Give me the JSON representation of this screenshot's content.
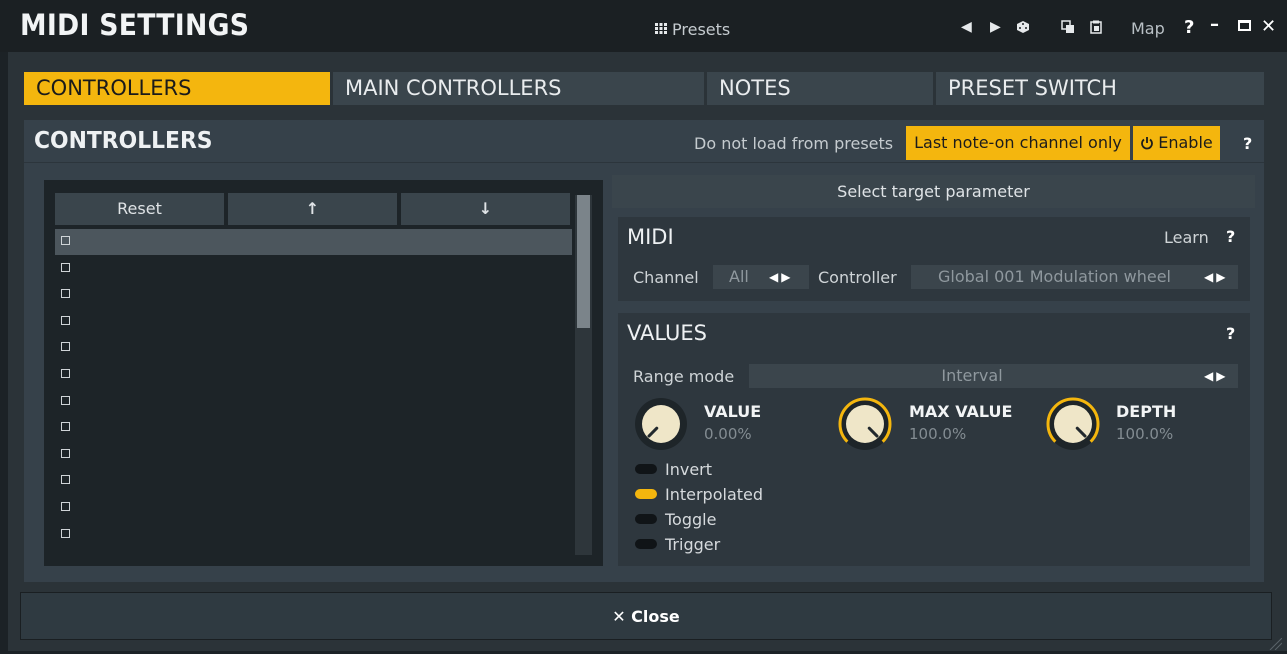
{
  "title": "MIDI SETTINGS",
  "titlebar": {
    "presets_label": "Presets",
    "map_label": "Map",
    "help_label": "?",
    "icons": [
      "prev-arrow-icon",
      "next-arrow-icon",
      "random-icon",
      "copy-icon",
      "paste-icon",
      "minimize-icon",
      "maximize-icon",
      "close-icon"
    ]
  },
  "tabs": [
    {
      "label": "CONTROLLERS",
      "active": true
    },
    {
      "label": "MAIN CONTROLLERS",
      "active": false
    },
    {
      "label": "NOTES",
      "active": false
    },
    {
      "label": "PRESET SWITCH",
      "active": false
    }
  ],
  "controllers": {
    "title": "CONTROLLERS",
    "do_not_load": "Do not load from presets",
    "last_note_on": "Last note-on channel only",
    "enable_label": "Enable",
    "help": "?"
  },
  "list": {
    "reset_label": "Reset",
    "up_label": "↑",
    "down_label": "↓",
    "row_count": 12,
    "selected_row": 0
  },
  "target_button": "Select target parameter",
  "midi": {
    "title": "MIDI",
    "learn_label": "Learn",
    "help": "?",
    "channel_label": "Channel",
    "channel_value": "All",
    "controller_label": "Controller",
    "controller_value": "Global 001 Modulation wheel"
  },
  "values": {
    "title": "VALUES",
    "help": "?",
    "range_mode_label": "Range mode",
    "range_mode_value": "Interval",
    "knobs": [
      {
        "name": "VALUE",
        "value": "0.00%",
        "level": 0.0
      },
      {
        "name": "MAX VALUE",
        "value": "100.0%",
        "level": 1.0
      },
      {
        "name": "DEPTH",
        "value": "100.0%",
        "level": 1.0
      }
    ],
    "toggles": [
      {
        "label": "Invert",
        "on": false
      },
      {
        "label": "Interpolated",
        "on": true
      },
      {
        "label": "Toggle",
        "on": false
      },
      {
        "label": "Trigger",
        "on": false
      }
    ]
  },
  "close_label": "✕ Close",
  "colors": {
    "accent": "#f4b60e",
    "panel": "#36414a",
    "background": "#2b3338"
  }
}
